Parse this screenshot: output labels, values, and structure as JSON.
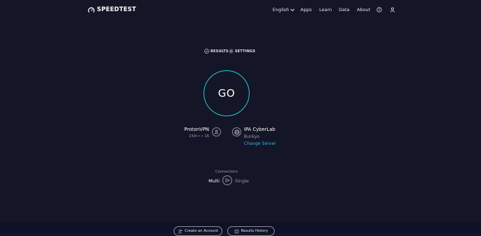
{
  "header": {
    "logo_text": "SPEEDTEST",
    "nav": [
      {
        "label": "English"
      },
      {
        "label": "Apps"
      },
      {
        "label": "Learn"
      },
      {
        "label": "Data"
      },
      {
        "label": "About"
      }
    ]
  },
  "tabs": {
    "results": "RESULTS",
    "settings": "SETTINGS"
  },
  "go_button": {
    "label": "GO"
  },
  "isp": {
    "name": "ProtonVPN",
    "ip": "159•• • 16"
  },
  "server": {
    "name": "IPA CyberLab",
    "location": "Bunkyo",
    "change_label": "Change Server"
  },
  "connections": {
    "label": "Connections",
    "multi": "Multi",
    "single": "Single"
  },
  "footer": {
    "create_account": "Create an Account",
    "results_history": "Results History"
  },
  "colors": {
    "background": "#141526",
    "accent_ring": "#1fd1d3",
    "link": "#35b7f0"
  }
}
